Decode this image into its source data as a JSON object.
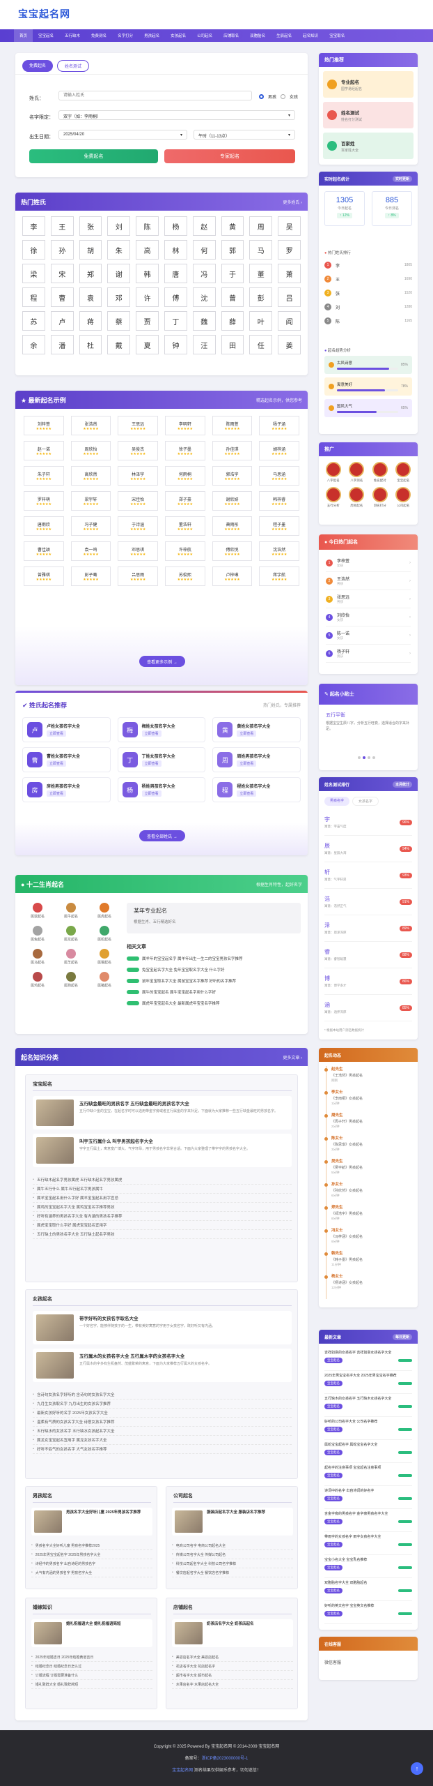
{
  "site": {
    "logo": "宝宝起名网"
  },
  "nav": [
    "首页",
    "宝宝起名",
    "五行缺木",
    "免费测名",
    "名字打分",
    "男孩起名",
    "女孩起名",
    "公司起名",
    "店铺取名",
    "双胞胎名",
    "生辰起名",
    "起名知识",
    "宝宝取名"
  ],
  "form": {
    "tabs": [
      "免费起名",
      "姓名测试"
    ],
    "surname_label": "姓氏：",
    "surname_placeholder": "请输入姓氏",
    "gender_male": "男孩",
    "gender_female": "女孩",
    "generation_label": "名字限定：",
    "generation_value": "双字（如：李雨桐）",
    "birth_label": "出生日期：",
    "birth_value": "2025/04/20",
    "hour_value": "午时（11-13点）",
    "submit_free": "免费起名",
    "submit_pro": "专家起名"
  },
  "surnames": {
    "title": "热门姓氏",
    "more": "更多姓氏 ›",
    "list": [
      "李",
      "王",
      "张",
      "刘",
      "陈",
      "杨",
      "赵",
      "黄",
      "周",
      "吴",
      "徐",
      "孙",
      "胡",
      "朱",
      "高",
      "林",
      "何",
      "郭",
      "马",
      "罗",
      "梁",
      "宋",
      "郑",
      "谢",
      "韩",
      "唐",
      "冯",
      "于",
      "董",
      "萧",
      "程",
      "曹",
      "袁",
      "邓",
      "许",
      "傅",
      "沈",
      "曾",
      "彭",
      "吕",
      "苏",
      "卢",
      "蒋",
      "蔡",
      "贾",
      "丁",
      "魏",
      "薛",
      "叶",
      "阎",
      "余",
      "潘",
      "杜",
      "戴",
      "夏",
      "钟",
      "汪",
      "田",
      "任",
      "姜"
    ]
  },
  "examples": {
    "title": "最新起名示例",
    "subtitle": "精选起名示例，供您参考",
    "names": [
      "刘梓萱",
      "张浩然",
      "王思远",
      "李明轩",
      "陈雨萱",
      "杨子涵",
      "赵一诺",
      "周欣怡",
      "吴俊杰",
      "徐子墨",
      "孙佳琪",
      "胡梓涵",
      "朱子轩",
      "高欣然",
      "林泽宇",
      "何雨桐",
      "郭浩宇",
      "马思涵",
      "罗梓萌",
      "梁宇轩",
      "宋佳怡",
      "郑子豪",
      "谢欣妍",
      "韩梓睿",
      "唐雨欣",
      "冯子健",
      "于诗涵",
      "董浩轩",
      "萧雨彤",
      "程子墨",
      "曹佳颖",
      "袁一鸣",
      "邓思琪",
      "许梓航",
      "傅欣悦",
      "沈浩然",
      "曾雅琪",
      "彭子骞",
      "吕思雨",
      "苏俊熙",
      "卢梓琳",
      "蒋宇航"
    ],
    "stars": "★★★★★",
    "button": "查看更多示例 →"
  },
  "hotnames": {
    "title": "姓氏起名推荐",
    "subtitle": "热门姓氏，专属推荐",
    "items": [
      {
        "icon": "卢",
        "name": "卢姓女孩名字大全",
        "tag": "立即查看"
      },
      {
        "icon": "梅",
        "name": "梅姓女孩名字大全",
        "tag": "立即查看"
      },
      {
        "icon": "黄",
        "name": "黄姓女孩名字大全",
        "tag": "立即查看"
      },
      {
        "icon": "曹",
        "name": "曹姓女孩名字大全",
        "tag": "立即查看"
      },
      {
        "icon": "丁",
        "name": "丁姓女孩名字大全",
        "tag": "立即查看"
      },
      {
        "icon": "周",
        "name": "周姓男孩名字大全",
        "tag": "立即查看"
      },
      {
        "icon": "房",
        "name": "房姓男孩名字大全",
        "tag": "立即查看"
      },
      {
        "icon": "杨",
        "name": "杨姓男孩名字大全",
        "tag": "立即查看"
      },
      {
        "icon": "程",
        "name": "程姓女孩名字大全",
        "tag": "立即查看"
      }
    ],
    "button": "查看全部姓氏 →"
  },
  "zodiac": {
    "title": "十二生肖起名",
    "subtitle": "根据生肖特性，起好名字",
    "animals": [
      "属鼠起名",
      "属牛起名",
      "属虎起名",
      "属兔起名",
      "属龙起名",
      "属蛇起名",
      "属马起名",
      "属羊起名",
      "属猴起名",
      "属鸡起名",
      "属狗起名",
      "属猪起名"
    ],
    "feature_title": "某年专业起名",
    "feature_desc": "根据生肖、五行精选好名",
    "articles_title": "相关文章",
    "articles": [
      "属羊年的宝宝起名字 属羊年出生一生二的宝宝男孩名字推荐",
      "兔宝宝起名字大全 兔年宝宝取名字大全 什么字好",
      "鼠年宝宝取名字大全 属鼠宝宝名字推荐 好听的名字推荐",
      "属牛的宝宝起名 属牛宝宝起名字用什么字好",
      "属虎年宝宝起名大全 最新属虎年宝宝名字推荐"
    ]
  },
  "knowledge": {
    "title": "起名知识分类",
    "more": "更多文章 ›",
    "block1": {
      "title": "宝宝起名",
      "feature": [
        {
          "title": "五行缺金最旺的男孩名字 五行缺金最旺的男孩名字大全",
          "desc": "五行中缺少金的宝宝，在起名字时可以选用带金字旁或者五行属金的字来补足，下面就为大家推荐一些五行缺金最旺的男孩名字。"
        },
        {
          "title": "叫宇五行属什么 叫宇男孩起名字大全",
          "desc": "宇字五行属土，寓意宽广博大、气宇轩昂，用于男孩名字非常合适。下面为大家整理了带宇字的男孩名字大全。"
        }
      ],
      "links": [
        "五行缺木起名字男孩属虎 五行缺木起名字男孩属虎",
        "属牛五行什么 属牛五行起名字男孩属牛",
        "属羊宝宝起名用什么字好 属羊宝宝起名用字宜忌",
        "属鸡的宝宝起名字大全 属鸡宝宝名字推荐男孩",
        "好听有涵养的男孩名字大全 有内涵的男孩名字推荐",
        "属虎宝宝取什么字好 属虎宝宝起名宜用字",
        "五行缺土的男孩名字大全 五行缺土起名字男孩"
      ]
    },
    "block2": {
      "title": "女孩起名",
      "feature": [
        {
          "title": "带字好听的女孩名字取名大全",
          "desc": "一个好名字，能够伴随孩子的一生，带有美好寓意的字用于女孩名字，既好听又有内涵。"
        },
        {
          "title": "五行属木的女孩名字大全 五行属木字的女孩名字大全",
          "desc": "五行属木的字多有生机盎然、茂盛繁荣的寓意，下面为大家推荐五行属木的女孩名字。"
        }
      ],
      "links": [
        "含诗句女孩名字好听的 含诗句的女孩名字大全",
        "九月生女孩取名字 九月出生的女孩名字推荐",
        "最新女孩好听的名字 2025年女孩名字大全",
        "温柔有气质的女孩名字大全 诗意女孩名字推荐",
        "五行缺水的女孩名字 五行缺水女孩起名字大全",
        "属龙女宝宝起名宜用字 属龙女孩名字大全",
        "好听不俗气的女孩名字 大气女孩名字推荐"
      ]
    },
    "block3": {
      "title": "男孩起名",
      "feature": {
        "title": "男孩名字大全好听儿童 2025年男孩名字推荐",
        "desc": ""
      },
      "links": [
        "男孩名字大全好听儿童 男孩名字推荐2025",
        "2025年男宝宝起名字 2025年男孩名字大全",
        "诗经中的男孩名字 出自诗经的男孩名字",
        "大气有内涵的男孩名字 男孩名字大全"
      ]
    },
    "block4": {
      "title": "公司起名",
      "feature": {
        "title": "服装店起名字大全 服装店名字推荐",
        "desc": ""
      },
      "links": [
        "电商公司名字 电商公司起名大全",
        "传媒公司名字大全 传媒公司起名",
        "科技公司起名字大全 科技公司名字推荐",
        "餐饮店起名字大全 餐饮店名字推荐"
      ]
    },
    "block5": {
      "title": "婚嫁知识",
      "feature": {
        "title": "婚礼祝福语大全 婚礼祝福语简短",
        "desc": ""
      },
      "links": [
        "2025年结婚吉日 2025年结婚黄道吉日",
        "结婚纪念日 结婚纪念日怎么过",
        "订婚流程 订婚需要准备什么",
        "婚礼致辞大全 婚礼致辞简短"
      ]
    },
    "block6": {
      "title": "店铺起名",
      "feature": {
        "title": "奶茶店名字大全 奶茶店起名",
        "desc": ""
      },
      "links": [
        "美容店名字大全 美容店起名",
        "花店名字大全 花店起名字",
        "超市名字大全 超市起名",
        "水果店名字 水果店起名大全"
      ]
    }
  },
  "sidebar": {
    "hot_title": "热门推荐",
    "hot": [
      {
        "name": "专业起名",
        "desc": "国学易经起名"
      },
      {
        "name": "姓名测试",
        "desc": "姓名打分测试"
      },
      {
        "name": "百家姓",
        "desc": "百家姓大全"
      }
    ],
    "stats_title": "实时起名统计",
    "stats_badge": "实时更新",
    "stat1": {
      "num": "1305",
      "label": "今日起名",
      "delta": "↑ 12%"
    },
    "stat2": {
      "num": "885",
      "label": "今日测名",
      "delta": "↑ 8%"
    },
    "rank_title": "热门姓氏排行",
    "rank": [
      {
        "n": "李",
        "v": "1805"
      },
      {
        "n": "王",
        "v": "1690"
      },
      {
        "n": "张",
        "v": "1520"
      },
      {
        "n": "刘",
        "v": "1280"
      },
      {
        "n": "陈",
        "v": "1165"
      }
    ],
    "trend_title": "起名趋势分析",
    "trends": [
      {
        "t": "古风诗意",
        "v": "85%"
      },
      {
        "t": "寓意美好",
        "v": "78%"
      },
      {
        "t": "国风大气",
        "v": "65%"
      }
    ],
    "promo_title": "推广",
    "seals": [
      "八字起名",
      "八字测名",
      "姓名配对",
      "宝宝起名",
      "五行分析",
      "周易起名",
      "测名打分",
      "公司起名"
    ],
    "today_title": "今日热门起名",
    "today": [
      {
        "n": "李梓萱",
        "d": "女孩"
      },
      {
        "n": "王浩然",
        "d": "男孩"
      },
      {
        "n": "张思远",
        "d": "男孩"
      },
      {
        "n": "刘欣怡",
        "d": "女孩"
      },
      {
        "n": "陈一诺",
        "d": "女孩"
      },
      {
        "n": "杨子轩",
        "d": "男孩"
      }
    ],
    "tips_title": "起名小贴士",
    "tips_item": "五行平衡",
    "tips_desc": "根据宝宝生辰八字，分析五行旺衰，选择适合的字来补足。",
    "analysis_title": "姓名测试排行",
    "analysis_badge": "本月统计",
    "analysis_tabs": [
      "男孩名字",
      "女孩名字"
    ],
    "analysis": [
      {
        "ch": "宇",
        "d": "寓意：宇宙气度",
        "s": "96%"
      },
      {
        "ch": "辰",
        "d": "寓意：星辰大海",
        "s": "94%"
      },
      {
        "ch": "轩",
        "d": "寓意：气宇轩昂",
        "s": "93%"
      },
      {
        "ch": "浩",
        "d": "寓意：浩然正气",
        "s": "91%"
      },
      {
        "ch": "泽",
        "d": "寓意：恩泽深厚",
        "s": "89%"
      },
      {
        "ch": "睿",
        "d": "寓意：睿智聪慧",
        "s": "88%"
      },
      {
        "ch": "博",
        "d": "寓意：博学多才",
        "s": "86%"
      },
      {
        "ch": "涵",
        "d": "寓意：涵养深厚",
        "s": "85%"
      }
    ],
    "analysis_note": "* 根据本站用户测名数据统计",
    "timeline_title": "起名动态",
    "timeline": [
      {
        "n": "赵先生",
        "t": "《王浩然》男孩起名",
        "r": "刚刚"
      },
      {
        "n": "李女士",
        "t": "《李雨桐》女孩起名",
        "r": "1分钟"
      },
      {
        "n": "周先生",
        "t": "《周子轩》男孩起名",
        "r": "2分钟"
      },
      {
        "n": "陈女士",
        "t": "《陈思琪》女孩起名",
        "r": "3分钟"
      },
      {
        "n": "吴先生",
        "t": "《吴宇航》男孩起名",
        "r": "5分钟"
      },
      {
        "n": "孙女士",
        "t": "《孙欣然》女孩起名",
        "r": "6分钟"
      },
      {
        "n": "郑先生",
        "t": "《郑浩宇》男孩起名",
        "r": "8分钟"
      },
      {
        "n": "冯女士",
        "t": "《冯梓涵》女孩起名",
        "r": "9分钟"
      },
      {
        "n": "韩先生",
        "t": "《韩子墨》男孩起名",
        "r": "11分钟"
      },
      {
        "n": "杨女士",
        "t": "《杨诗涵》女孩起名",
        "r": "12分钟"
      }
    ],
    "news_title": "最新文章",
    "news_badge": "每日更新",
    "news": [
      "吉祥如意的女孩名字 吉祥如意女孩名字大全",
      "2025年男宝宝名字大全 2025年男宝宝名字推荐",
      "五行缺木的女孩名字 五行缺木女孩名字大全",
      "好听的公司名字大全 公司名字推荐",
      "属蛇宝宝起名字 属蛇宝宝名字大全",
      "起名字的注意事项 宝宝起名注意事项",
      "诗词中的名字 出自诗词的好名字",
      "含金字旁的男孩名字 金字旁男孩名字大全",
      "带雨字的女孩名字 雨字女孩名字大全",
      "宝宝小名大全 宝宝乳名推荐",
      "双胞胎名字大全 双胞胎起名",
      "好听的英文名字 宝宝英文名推荐"
    ],
    "news_tag": "宝宝起名",
    "contact_title": "在线客服",
    "contact_desc": "微信客服"
  },
  "footer": {
    "copy": "Copyright © 2025 Powered By 宝宝起名网 © 2014-2009 宝宝起名网",
    "icp": "备案号：",
    "icp_link": "浙ICP备2023000000号-1",
    "note_prefix": "宝宝起名网",
    "note": "测名结果仅供娱乐参考，切勿迷信！"
  }
}
